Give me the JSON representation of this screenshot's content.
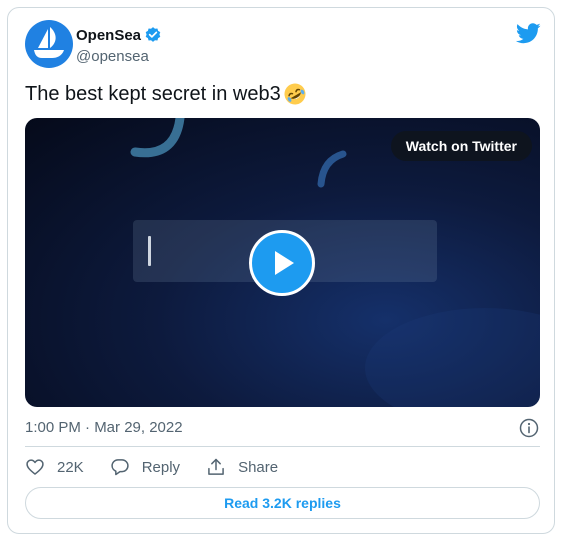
{
  "author": {
    "display_name": "OpenSea",
    "handle": "@opensea",
    "avatar_color": "#2081e2",
    "verified": true,
    "avatar_icon": "opensea-logo-icon"
  },
  "tweet": {
    "text": "The best kept secret in web3",
    "emoji": "rolling-on-floor-laughing-emoji",
    "timestamp": "1:00 PM · Mar 29, 2022"
  },
  "media": {
    "watch_label": "Watch on Twitter",
    "play_icon": "play-icon"
  },
  "actions": {
    "likes": "22K",
    "reply_label": "Reply",
    "share_label": "Share",
    "read_replies_label": "Read 3.2K replies"
  },
  "colors": {
    "accent": "#1d9bf0",
    "text_primary": "#0f1419",
    "text_secondary": "#536471",
    "border": "#cfd9de"
  }
}
